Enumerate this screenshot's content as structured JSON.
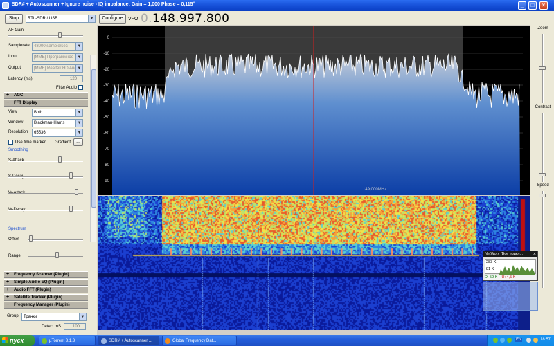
{
  "window": {
    "title": "SDR# + Autoscanner + Ignore noise - IQ imbalance: Gain = 1,000 Phase = 0,115°"
  },
  "toolbar": {
    "stop_label": "Stop",
    "source_value": "RTL-SDR / USB",
    "configure_label": "Configure",
    "vfo_label": "VFO",
    "vfo_dim": "0.",
    "vfo_value": "148.997.800"
  },
  "left": {
    "af_gain_label": "AF Gain",
    "af_gain_level": 0.7,
    "samplerate_label": "Samplerate",
    "samplerate_value": "48000 sample/sec",
    "input_label": "Input",
    "input_value": "[MME] Программное м",
    "output_label": "Output",
    "output_value": "[MME] Realtek HD Auc",
    "latency_label": "Latency (ms)",
    "latency_value": "120",
    "filter_audio_label": "Filter Audio",
    "agc_header": "AGC",
    "fft_header": "FFT Display",
    "view_label": "View",
    "view_value": "Both",
    "window_label": "Window",
    "window_value": "Blackman-Harris",
    "resolution_label": "Resolution",
    "resolution_value": "65536",
    "time_marker_label": "Use  time marker",
    "gradient_label": "Gradient",
    "gradient_btn": "...",
    "smoothing_label": "Smoothing",
    "sattack_label": "S-Attack",
    "sdecay_label": "S-Decay",
    "wattack_label": "W-Attack",
    "wdecay_label": "W-Decay",
    "spectrum_label": "Spectrum",
    "offset_label": "Offset",
    "range_label": "Range",
    "plugins": [
      "Frequency Scanner (Plugin)",
      "Simple Audio EQ (Plugin)",
      "Audio FFT (Plugin)",
      "Satellite Tracker (Plugin)",
      "Frequency Manager (Plugin)"
    ],
    "group_label": "Group:",
    "group_value": "Транки",
    "detect_label": "Detect mS",
    "detect_value": "100"
  },
  "spectrum": {
    "y_ticks": [
      "0",
      "-10",
      "-20",
      "-30",
      "-40",
      "-50",
      "-60",
      "-70",
      "-80",
      "-90"
    ],
    "center_label": "149,000MHz"
  },
  "right": {
    "zoom_label": "Zoom",
    "contrast_label": "Contrast",
    "speed_label": "Speed"
  },
  "network": {
    "title": "NetWorx (Все подкл...",
    "max_label": "283 K",
    "mid_label": "81 K",
    "down_label": "D: 59 K",
    "up_label": "U: 4,5 K"
  },
  "taskbar": {
    "start_label": "пуск",
    "tasks": [
      "µTorrent 3.1.3",
      "SDR# + Autoscanner ...",
      "Global Frequency Dat..."
    ],
    "lang": "EN",
    "clock": "18:57"
  },
  "colors": {
    "accent": "#245edb",
    "spectrum_fill": "#2a6fd0",
    "center_line": "#d02020"
  }
}
